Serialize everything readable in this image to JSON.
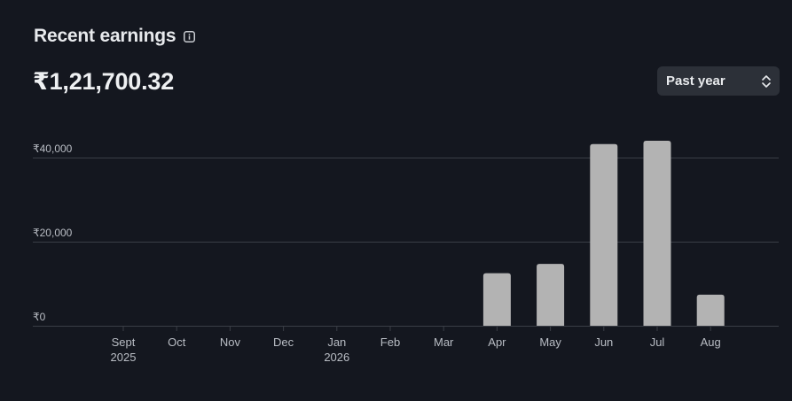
{
  "header": {
    "title": "Recent earnings",
    "info_icon": "info-icon",
    "total": "₹1,21,700.32"
  },
  "range_select": {
    "selected": "Past year",
    "icon": "updown-chevron-icon"
  },
  "colors": {
    "background": "#14171f",
    "bar": "#b3b3b3",
    "grid": "#3a3e46",
    "select_bg": "#2c3038"
  },
  "chart_data": {
    "type": "bar",
    "categories": [
      "Sept",
      "Oct",
      "Nov",
      "Dec",
      "Jan",
      "Feb",
      "Mar",
      "Apr",
      "May",
      "Jun",
      "Jul",
      "Aug"
    ],
    "category_sublabels": [
      "2025",
      "",
      "",
      "",
      "2026",
      "",
      "",
      "",
      "",
      "",
      "",
      ""
    ],
    "values": [
      0,
      0,
      0,
      0,
      0,
      0,
      0,
      12500,
      14700,
      43200,
      44000,
      7400
    ],
    "y_ticks": [
      0,
      20000,
      40000
    ],
    "y_tick_labels": [
      "₹0",
      "₹20,000",
      "₹40,000"
    ],
    "ylim": [
      0,
      40000
    ],
    "grid": true,
    "legend": "none"
  }
}
